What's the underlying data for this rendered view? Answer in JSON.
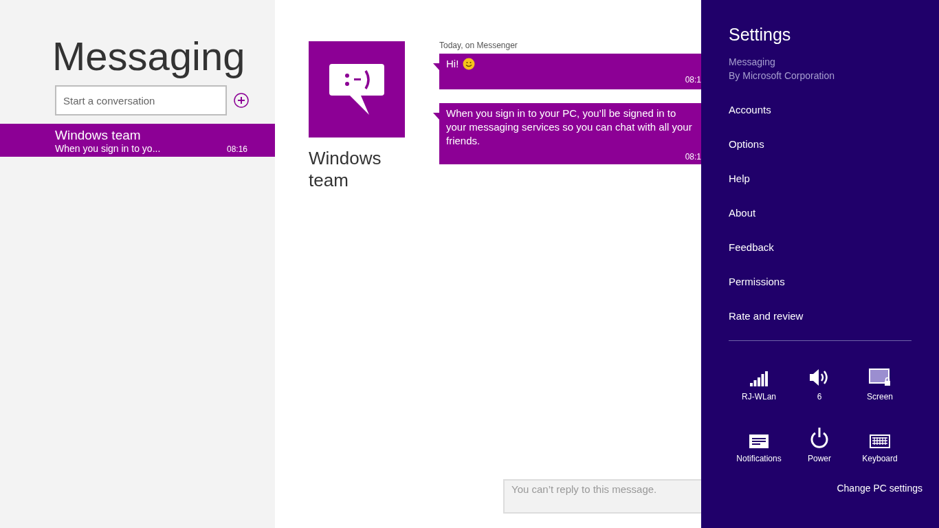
{
  "app": {
    "title": "Messaging"
  },
  "search": {
    "placeholder": "Start a conversation"
  },
  "conversations": [
    {
      "name": "Windows team",
      "preview": "When you sign in to yo...",
      "time": "08:16",
      "selected": true
    }
  ],
  "chat": {
    "contact": "Windows team",
    "source": "Today, on Messenger",
    "messages": [
      {
        "text": "Hi!",
        "emoji": true,
        "time": "08:1"
      },
      {
        "text": "When you sign in to your PC, you’ll be signed in to your messaging services so you can chat with all your friends.",
        "emoji": false,
        "time": "08:1"
      }
    ],
    "reply_placeholder": "You can’t reply to this message."
  },
  "settings": {
    "title": "Settings",
    "app_name": "Messaging",
    "publisher": "By Microsoft Corporation",
    "items": [
      "Accounts",
      "Options",
      "Help",
      "About",
      "Feedback",
      "Permissions",
      "Rate and review"
    ],
    "quick": [
      {
        "kind": "wifi",
        "label": "RJ-WLan"
      },
      {
        "kind": "volume",
        "label": "6"
      },
      {
        "kind": "screen",
        "label": "Screen"
      },
      {
        "kind": "notifications",
        "label": "Notifications"
      },
      {
        "kind": "power",
        "label": "Power"
      },
      {
        "kind": "keyboard",
        "label": "Keyboard"
      }
    ],
    "change_link": "Change PC settings"
  }
}
